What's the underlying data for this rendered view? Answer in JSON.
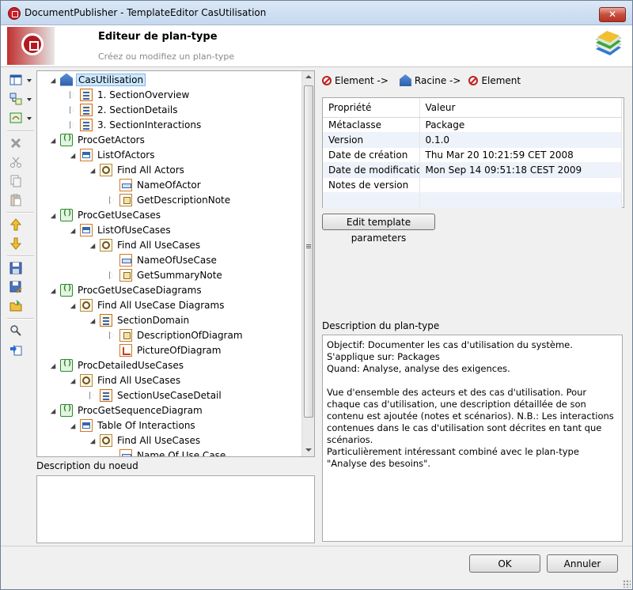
{
  "window": {
    "title": "DocumentPublisher - TemplateEditor CasUtilisation",
    "close_label": "✕"
  },
  "banner": {
    "heading": "Editeur de plan-type",
    "subtitle": "Créez ou modifiez un plan-type"
  },
  "tree": {
    "items": [
      {
        "label": "CasUtilisation",
        "depth": 0,
        "twisty": "open",
        "icon": "package-icon",
        "selected": true
      },
      {
        "label": "1. SectionOverview",
        "depth": 1,
        "twisty": "closed",
        "icon": "section-icon"
      },
      {
        "label": "2. SectionDetails",
        "depth": 1,
        "twisty": "closed",
        "icon": "section-icon"
      },
      {
        "label": "3. SectionInteractions",
        "depth": 1,
        "twisty": "closed",
        "icon": "section-icon"
      },
      {
        "label": "ProcGetActors",
        "depth": 0,
        "twisty": "open",
        "icon": "procedure-icon"
      },
      {
        "label": "ListOfActors",
        "depth": 1,
        "twisty": "open",
        "icon": "table-icon"
      },
      {
        "label": "Find All Actors",
        "depth": 2,
        "twisty": "open",
        "icon": "find-icon"
      },
      {
        "label": "NameOfActor",
        "depth": 3,
        "twisty": "none",
        "icon": "field-icon"
      },
      {
        "label": "GetDescriptionNote",
        "depth": 3,
        "twisty": "closed",
        "icon": "getter-icon"
      },
      {
        "label": "ProcGetUseCases",
        "depth": 0,
        "twisty": "open",
        "icon": "procedure-icon"
      },
      {
        "label": "ListOfUseCases",
        "depth": 1,
        "twisty": "open",
        "icon": "table-icon"
      },
      {
        "label": "Find All UseCases",
        "depth": 2,
        "twisty": "open",
        "icon": "find-icon"
      },
      {
        "label": "NameOfUseCase",
        "depth": 3,
        "twisty": "none",
        "icon": "field-icon"
      },
      {
        "label": "GetSummaryNote",
        "depth": 3,
        "twisty": "closed",
        "icon": "getter-icon"
      },
      {
        "label": "ProcGetUseCaseDiagrams",
        "depth": 0,
        "twisty": "open",
        "icon": "procedure-icon"
      },
      {
        "label": "Find All UseCase Diagrams",
        "depth": 1,
        "twisty": "open",
        "icon": "find-icon"
      },
      {
        "label": "SectionDomain",
        "depth": 2,
        "twisty": "open",
        "icon": "section-icon"
      },
      {
        "label": "DescriptionOfDiagram",
        "depth": 3,
        "twisty": "closed",
        "icon": "getter-icon"
      },
      {
        "label": "PictureOfDiagram",
        "depth": 3,
        "twisty": "none",
        "icon": "picture-icon"
      },
      {
        "label": "ProcDetailedUseCases",
        "depth": 0,
        "twisty": "open",
        "icon": "procedure-icon"
      },
      {
        "label": "Find All UseCases",
        "depth": 1,
        "twisty": "open",
        "icon": "find-icon"
      },
      {
        "label": "SectionUseCaseDetail",
        "depth": 2,
        "twisty": "closed",
        "icon": "section-icon"
      },
      {
        "label": "ProcGetSequenceDiagram",
        "depth": 0,
        "twisty": "open",
        "icon": "procedure-icon"
      },
      {
        "label": "Table Of Interactions",
        "depth": 1,
        "twisty": "open",
        "icon": "table-icon"
      },
      {
        "label": "Find All UseCases",
        "depth": 2,
        "twisty": "open",
        "icon": "find-icon"
      },
      {
        "label": "Name Of Use Case",
        "depth": 3,
        "twisty": "none",
        "icon": "field-icon"
      }
    ]
  },
  "node_description": {
    "label": "Description du noeud",
    "value": ""
  },
  "breadcrumb": {
    "part1": "Element ->",
    "part2": "Racine ->",
    "part3": "Element"
  },
  "properties": {
    "headers": [
      "Propriété",
      "Valeur"
    ],
    "rows": [
      [
        "Métaclasse",
        "Package"
      ],
      [
        "Version",
        "0.1.0"
      ],
      [
        "Date de création",
        "Thu Mar 20 10:21:59 CET 2008"
      ],
      [
        "Date de modification",
        "Mon Sep 14 09:51:18 CEST 2009"
      ],
      [
        "Notes de version",
        ""
      ],
      [
        "",
        ""
      ]
    ]
  },
  "edit_params_label": "Edit template parameters",
  "plan_description": {
    "label": "Description du plan-type",
    "text": "Objectif: Documenter les cas d'utilisation du système.\nS'applique sur: Packages\nQuand: Analyse, analyse des exigences.\n\nVue d'ensemble des acteurs et des cas d'utilisation. Pour chaque cas d'utilisation, une description détaillée de son contenu est ajoutée (notes et scénarios). N.B.: Les interactions contenues dans le cas d'utilisation sont décrites en tant que scénarios.\nParticulièrement intéressant combiné avec le plan-type \"Analyse des besoins\"."
  },
  "buttons": {
    "ok": "OK",
    "cancel": "Annuler"
  }
}
